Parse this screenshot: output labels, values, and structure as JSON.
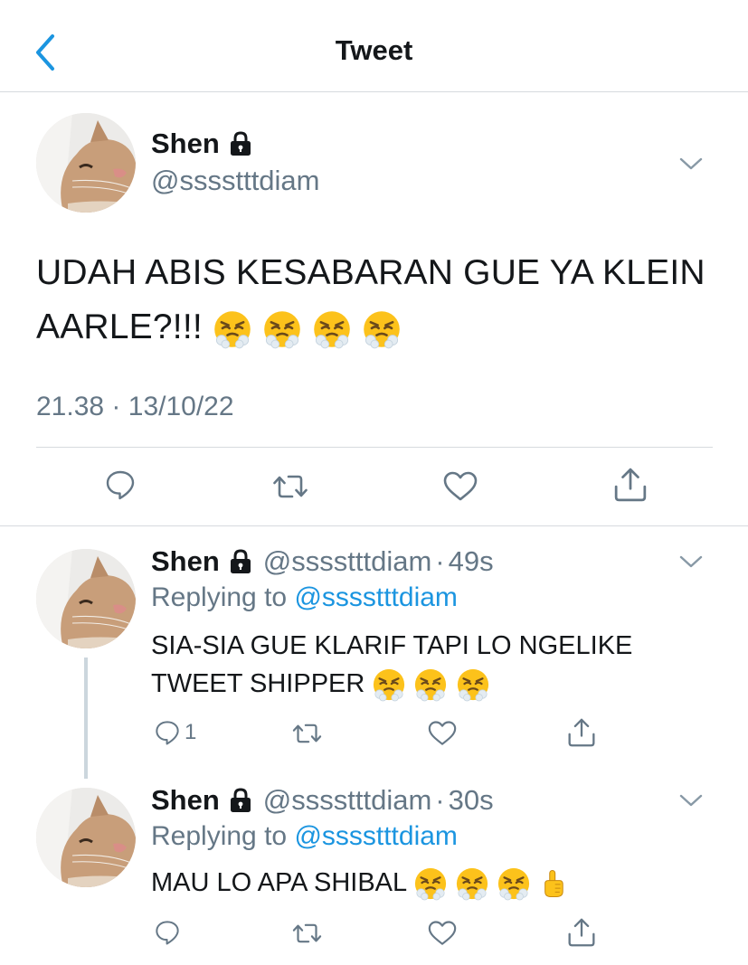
{
  "header": {
    "title": "Tweet",
    "back_icon": "chevron-left-icon"
  },
  "main_tweet": {
    "name": "Shen",
    "handle": "@sssstttdiam",
    "text": "UDAH ABIS KESABARAN GUE YA KLEIN AARLE?!!!",
    "emojis": [
      "face-with-steam-icon",
      "face-with-steam-icon",
      "face-with-steam-icon",
      "face-with-steam-icon"
    ],
    "time": "21.38",
    "date": "13/10/22",
    "meta_separator": "·"
  },
  "replies": [
    {
      "name": "Shen",
      "handle": "@sssstttdiam",
      "separator": "·",
      "time": "49s",
      "replying_label": "Replying to",
      "replying_handle": "@sssstttdiam",
      "text_line1": "SIA-SIA GUE KLARIF TAPI LO NGELIKE",
      "text_line2": "TWEET SHIPPER",
      "emojis": [
        "face-with-steam-icon",
        "face-with-steam-icon",
        "face-with-steam-icon"
      ],
      "reply_count": "1"
    },
    {
      "name": "Shen",
      "handle": "@sssstttdiam",
      "separator": "·",
      "time": "30s",
      "replying_label": "Replying to",
      "replying_handle": "@sssstttdiam",
      "text_line1": "MAU LO APA SHIBAL",
      "emojis": [
        "face-with-steam-icon",
        "face-with-steam-icon",
        "face-with-steam-icon",
        "pointing-up-icon"
      ],
      "reply_count": ""
    }
  ],
  "colors": {
    "text": "#14171a",
    "secondary": "#657786",
    "link": "#1b95e0",
    "divider": "#d6dade",
    "thread_line": "#ccd6dd"
  }
}
